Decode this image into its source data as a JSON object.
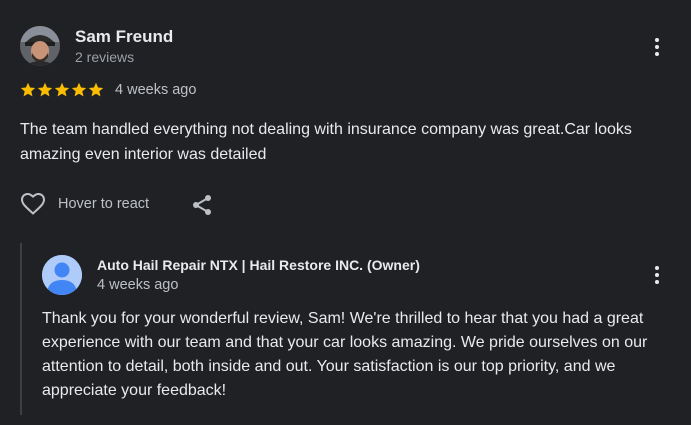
{
  "review": {
    "author": "Sam Freund",
    "author_meta": "2 reviews",
    "rating": 5,
    "max_rating": 5,
    "time": "4 weeks ago",
    "text": "The team handled everything not dealing with insurance company was great.Car looks amazing even interior was detailed",
    "react_label": "Hover to react",
    "icons": {
      "menu": "more-vert-icon",
      "react": "heart-outline-icon",
      "share": "share-icon",
      "star": "star-icon"
    }
  },
  "reply": {
    "author": "Auto Hail Repair NTX | Hail Restore INC. (Owner)",
    "time": "4 weeks ago",
    "text": "Thank you for your wonderful review, Sam! We're thrilled to hear that you had a great experience with our team and that your car looks amazing. We pride ourselves on our attention to detail, both inside and out. Your satisfaction is our top priority, and we appreciate your feedback!",
    "icons": {
      "menu": "more-vert-icon",
      "avatar": "default-avatar-icon"
    }
  },
  "colors": {
    "background": "#202124",
    "star": "#fbbc04",
    "primary_text": "#e8eaed",
    "secondary_text": "#bdc1c6",
    "owner_avatar": "#aecbfa",
    "owner_avatar_figure": "#4285f4"
  }
}
